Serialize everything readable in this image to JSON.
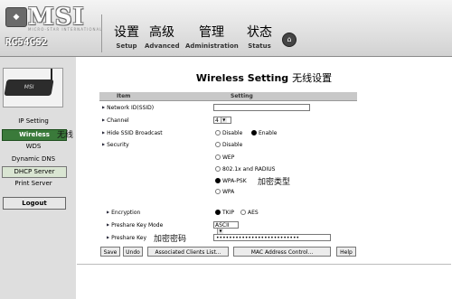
{
  "brand": {
    "logo": "MSI",
    "logo_sub": "MICRO-STAR INTERNATIONAL",
    "model": "RG54GS2"
  },
  "nav": [
    {
      "zh": "设置",
      "en": "Setup"
    },
    {
      "zh": "高级",
      "en": "Advanced"
    },
    {
      "zh": "管理",
      "en": "Administration"
    },
    {
      "zh": "状态",
      "en": "Status"
    }
  ],
  "sidebar": {
    "items": [
      "IP Setting",
      "Wireless",
      "WDS",
      "Dynamic DNS",
      "DHCP Server",
      "Print Server"
    ],
    "active": "Wireless",
    "logout": "Logout",
    "router_label": "MSI"
  },
  "annotations": {
    "wireless": "无线",
    "security_type": "加密类型",
    "password": "加密密码"
  },
  "page": {
    "title": "Wireless Setting",
    "title_zh": "无线设置"
  },
  "table": {
    "col_item": "Item",
    "col_setting": "Setting"
  },
  "rows": {
    "ssid_label": "Network ID(SSID)",
    "ssid_value": "",
    "channel_label": "Channel",
    "channel_value": "4",
    "hide_label": "Hide SSID Broadcast",
    "hide_options": [
      "Disable",
      "Enable"
    ],
    "hide_selected": "Enable",
    "security_label": "Security",
    "security_options": [
      "Disable",
      "WEP",
      "802.1x and RADIUS",
      "WPA-PSK",
      "WPA"
    ],
    "security_selected": "WPA-PSK",
    "encryption_label": "Encryption",
    "encryption_options": [
      "TKIP",
      "AES"
    ],
    "encryption_selected": "TKIP",
    "key_mode_label": "Preshare Key Mode",
    "key_mode_value": "ASCII",
    "key_label": "Preshare Key",
    "key_value": "••••••••••••••••••••••••••"
  },
  "buttons": [
    "Save",
    "Undo",
    "Associated Clients List...",
    "MAC Address Control...",
    "Help"
  ],
  "colors": {
    "active_green": "#3a7a3a",
    "header_gray": "#d2d2d2",
    "sidebar_gray": "#dedede"
  }
}
